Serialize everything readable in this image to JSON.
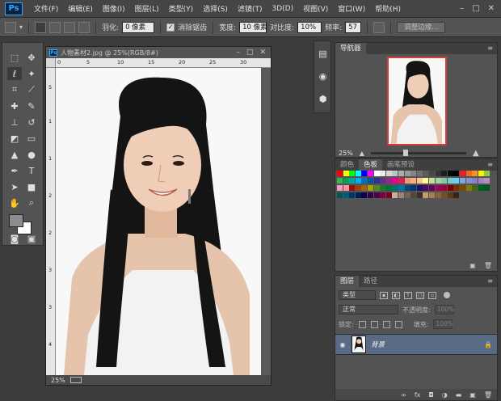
{
  "app": {
    "logo": "Ps",
    "menu": [
      "文件(F)",
      "编辑(E)",
      "图像(I)",
      "图层(L)",
      "类型(Y)",
      "选择(S)",
      "滤镜(T)",
      "3D(D)",
      "视图(V)",
      "窗口(W)",
      "帮助(H)"
    ],
    "window_controls": [
      "–",
      "□",
      "✕"
    ]
  },
  "options": {
    "feather_label": "羽化:",
    "feather_value": "0 像素",
    "antialias_label": "消除锯齿",
    "antialias_checked": true,
    "width_label": "宽度:",
    "width_value": "10 像素",
    "contrast_label": "对比度:",
    "contrast_value": "10%",
    "frequency_label": "频率:",
    "frequency_value": "57",
    "refine_edge_label": "调整边缘..."
  },
  "document": {
    "ps_badge": "Ps",
    "title": "人物素材2.jpg @ 25%(RGB/8#)",
    "zoom": "25%",
    "ruler_top": [
      "0",
      "5",
      "10",
      "15",
      "20",
      "25",
      "30"
    ],
    "ruler_left": [
      "5",
      "1",
      "1",
      "2",
      "2",
      "3",
      "3",
      "4"
    ]
  },
  "navigator": {
    "tab": "导航器",
    "zoom": "25%"
  },
  "swatches": {
    "tabs": [
      "颜色",
      "色板",
      "画笔预设"
    ],
    "active_tab": "色板",
    "colors": [
      "#ff0000",
      "#ffff00",
      "#00ff00",
      "#00ffff",
      "#0000ff",
      "#ff00ff",
      "#ffffff",
      "#ebebeb",
      "#d6d6d6",
      "#c2c2c2",
      "#adadad",
      "#999999",
      "#858585",
      "#707070",
      "#5c5c5c",
      "#474747",
      "#333333",
      "#1f1f1f",
      "#0a0a0a",
      "#000000",
      "#ee1d24",
      "#f26522",
      "#f7941d",
      "#fff200",
      "#8dc63f",
      "#39b54a",
      "#00a651",
      "#00a99d",
      "#00aeef",
      "#0072bc",
      "#0054a6",
      "#2e3192",
      "#662d91",
      "#92278f",
      "#ec008c",
      "#ed145b",
      "#f69679",
      "#f9ad81",
      "#fdc689",
      "#fff799",
      "#c4df9b",
      "#a3d39c",
      "#82ca9c",
      "#7accc8",
      "#6dcff6",
      "#7da7d9",
      "#8393ca",
      "#8781bd",
      "#a186be",
      "#bd8cbf",
      "#f49ac1",
      "#f5989d",
      "#9e0b0f",
      "#a0410d",
      "#a3620a",
      "#aba000",
      "#598527",
      "#1a7b30",
      "#007236",
      "#00746b",
      "#0076a3",
      "#004b80",
      "#003471",
      "#1b1464",
      "#440e62",
      "#630460",
      "#9e005d",
      "#9e0039",
      "#790000",
      "#7b2e00",
      "#7d4900",
      "#827b00",
      "#406618",
      "#005e20",
      "#005826",
      "#005952",
      "#005b7f",
      "#003663",
      "#002157",
      "#0d004c",
      "#32004b",
      "#4b0049",
      "#7b0046",
      "#7a0026",
      "#c7b299",
      "#998675",
      "#736357",
      "#534741",
      "#362f2d",
      "#c69c6d",
      "#a67c52",
      "#8c6239",
      "#754c24",
      "#603913",
      "#3c2415"
    ]
  },
  "layers": {
    "tabs": [
      "图层",
      "路径"
    ],
    "filter_label": "类型",
    "blend_mode": "正常",
    "opacity_label": "不透明度:",
    "opacity_value": "100%",
    "lock_label": "锁定:",
    "fill_label": "填充:",
    "fill_value": "100%",
    "layer_name": "背景"
  }
}
